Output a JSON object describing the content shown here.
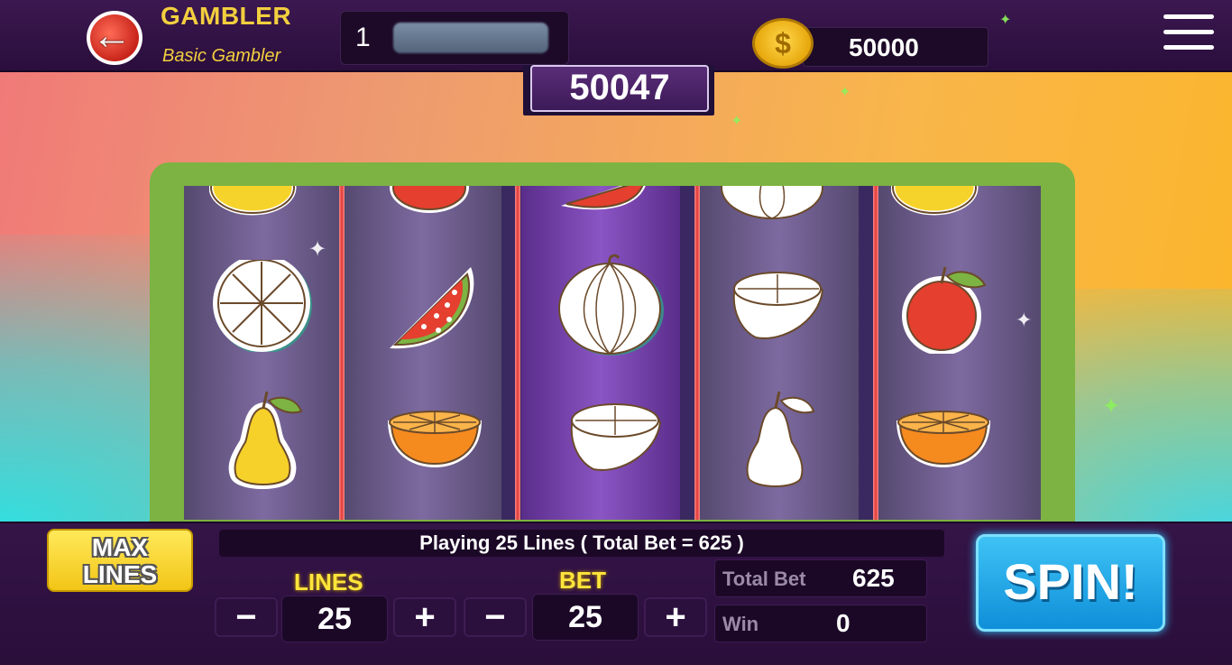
{
  "header": {
    "title": "GAMBLER",
    "subtitle": "Basic Gambler",
    "level": "1",
    "coins": "50000",
    "coin_symbol": "$"
  },
  "jackpot": "50047",
  "reels": [
    [
      "lemon",
      "orange-slice-white",
      "pear"
    ],
    [
      "apple",
      "watermelon",
      "orange-half"
    ],
    [
      "watermelon",
      "melon-white",
      "lemon-half-white"
    ],
    [
      "melon-white",
      "lemon-half-white",
      "pear-white"
    ],
    [
      "lemon",
      "apple",
      "orange-half"
    ]
  ],
  "controls": {
    "max_lines_label": "MAX LINES",
    "status_text": "Playing 25 Lines ( Total Bet = 625 )",
    "lines_label": "LINES",
    "lines_value": "25",
    "bet_label": "BET",
    "bet_value": "25",
    "minus": "−",
    "plus": "+",
    "total_bet_label": "Total Bet",
    "total_bet_value": "625",
    "win_label": "Win",
    "win_value": "0",
    "spin_label": "SPIN!"
  },
  "colors": {
    "frame": "#7cb342",
    "accent_yellow": "#ffe53b",
    "spin_blue": "#1aa6ea",
    "divider_red": "#e53935"
  }
}
